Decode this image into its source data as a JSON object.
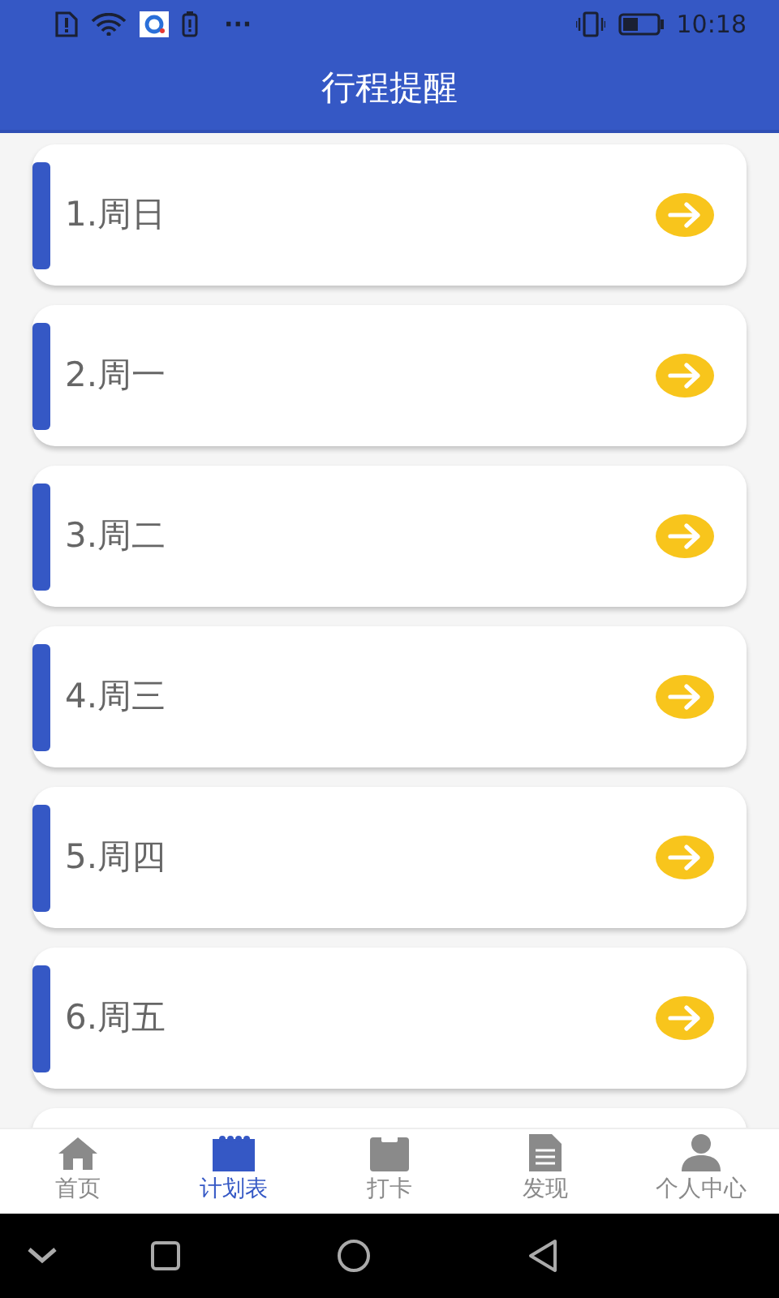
{
  "status_bar": {
    "overflow": "···",
    "time": "10:18"
  },
  "header": {
    "title": "行程提醒"
  },
  "days": [
    {
      "label": "1.周日"
    },
    {
      "label": "2.周一"
    },
    {
      "label": "3.周二"
    },
    {
      "label": "4.周三"
    },
    {
      "label": "5.周四"
    },
    {
      "label": "6.周五"
    }
  ],
  "tabs": [
    {
      "label": "首页",
      "kind": "home",
      "selected": false
    },
    {
      "label": "计划表",
      "kind": "calendar",
      "selected": true
    },
    {
      "label": "打卡",
      "kind": "clipboard",
      "selected": false
    },
    {
      "label": "发现",
      "kind": "document",
      "selected": false
    },
    {
      "label": "个人中心",
      "kind": "person",
      "selected": false
    }
  ]
}
